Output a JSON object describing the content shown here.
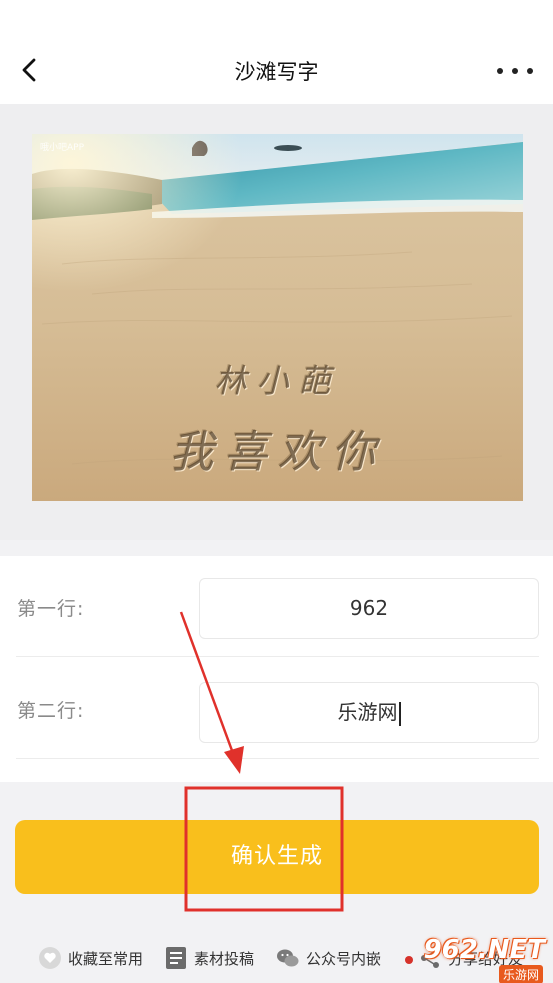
{
  "header": {
    "title": "沙滩写字",
    "back_icon": "chevron-left-icon",
    "more_icon": "more-horizontal-icon"
  },
  "preview": {
    "watermark": "哦小吧APP",
    "line1": "林小葩",
    "line2": "我喜欢你"
  },
  "form": {
    "rows": [
      {
        "label": "第一行:",
        "value": "962"
      },
      {
        "label": "第二行:",
        "value": "乐游网"
      }
    ]
  },
  "confirm_button": "确认生成",
  "footer": {
    "items": [
      {
        "label": "收藏至常用",
        "icon": "heart-icon"
      },
      {
        "label": "素材投稿",
        "icon": "document-icon"
      },
      {
        "label": "公众号内嵌",
        "icon": "wechat-icon"
      },
      {
        "label": "分享给好友",
        "icon": "share-icon"
      }
    ]
  },
  "site_logo": {
    "top": "962.NET",
    "bottom": "乐游网"
  },
  "colors": {
    "accent": "#f9bf1c",
    "annotation": "#e0312b",
    "page_bg": "#f2f2f4"
  }
}
